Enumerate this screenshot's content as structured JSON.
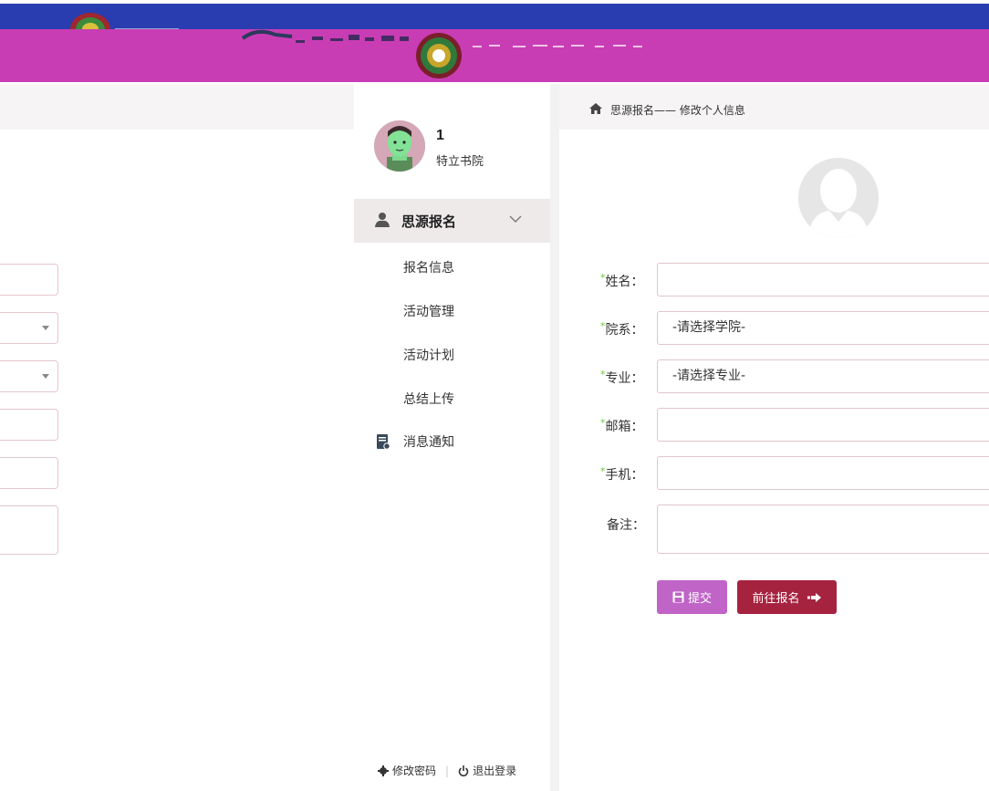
{
  "colors": {
    "top_bar": "#2a3db0",
    "banner": "#c93db4",
    "submit_button": "#c064c7",
    "goto_button": "#a62340",
    "required_mark": "#6ec24a"
  },
  "sidebar": {
    "user": {
      "name": "1",
      "college": "特立书院"
    },
    "menu_group": {
      "label": "思源报名",
      "icon": "user-icon",
      "expanded": true
    },
    "sub_items": [
      {
        "label": "报名信息"
      },
      {
        "label": "活动管理"
      },
      {
        "label": "活动计划"
      },
      {
        "label": "总结上传"
      }
    ],
    "message_item": {
      "label": "消息通知",
      "icon": "message-icon"
    },
    "footer": {
      "change_password": "修改密码",
      "logout": "退出登录",
      "separator": "|"
    }
  },
  "breadcrumb": {
    "icon": "home-icon",
    "text": "思源报名—— 修改个人信息"
  },
  "form": {
    "fields": [
      {
        "key": "name",
        "label": "姓名：",
        "required": true,
        "value": ""
      },
      {
        "key": "department",
        "label": "院系：",
        "required": true,
        "value": "-请选择学院-"
      },
      {
        "key": "major",
        "label": "专业：",
        "required": true,
        "value": "-请选择专业-"
      },
      {
        "key": "email",
        "label": "邮箱：",
        "required": true,
        "value": ""
      },
      {
        "key": "phone",
        "label": "手机：",
        "required": true,
        "value": ""
      },
      {
        "key": "remark",
        "label": "备注：",
        "required": false,
        "value": ""
      }
    ],
    "required_mark": "*",
    "submit_label": "提交",
    "goto_label": "前往报名"
  }
}
